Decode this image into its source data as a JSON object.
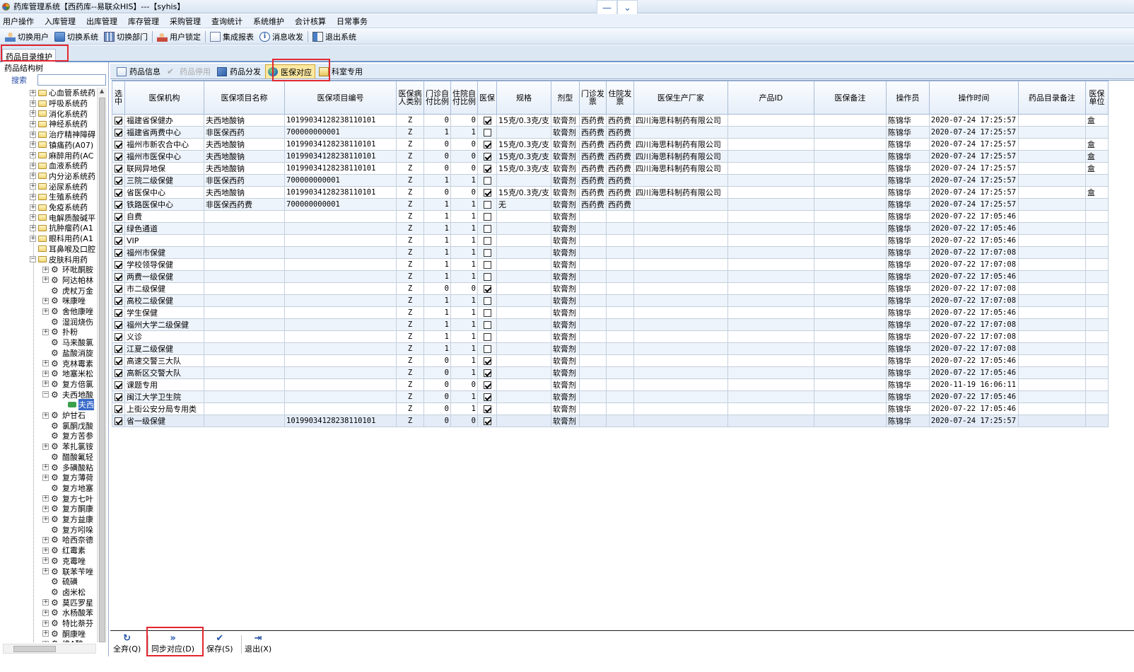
{
  "window": {
    "title": "药库管理系统【西药库--易联众HIS】---【syhis】"
  },
  "menu": [
    "用户操作",
    "入库管理",
    "出库管理",
    "库存管理",
    "采购管理",
    "查询统计",
    "系统维护",
    "会计核算",
    "日常事务"
  ],
  "toolbar": [
    {
      "label": "切换用户",
      "icon": "switch-user-icon"
    },
    {
      "label": "切换系统",
      "icon": "switch-system-icon"
    },
    {
      "label": "切换部门",
      "icon": "switch-dept-icon"
    },
    {
      "label": "用户锁定",
      "icon": "user-lock-icon"
    },
    {
      "label": "集成报表",
      "icon": "report-icon"
    },
    {
      "label": "消息收发",
      "icon": "message-icon"
    },
    {
      "label": "退出系统",
      "icon": "exit-icon"
    }
  ],
  "doc_tab": "药品目录维护",
  "tree": {
    "header": "药品结构树",
    "search_label": "搜索",
    "search_value": "",
    "items": [
      {
        "label": "心血管系统药",
        "level": 1,
        "type": "folder",
        "expander": "+"
      },
      {
        "label": "呼吸系统药",
        "level": 1,
        "type": "folder",
        "expander": "+"
      },
      {
        "label": "消化系统药",
        "level": 1,
        "type": "folder",
        "expander": "+"
      },
      {
        "label": "神经系统药",
        "level": 1,
        "type": "folder",
        "expander": "+"
      },
      {
        "label": "治疗精神障碍",
        "level": 1,
        "type": "folder",
        "expander": "+"
      },
      {
        "label": "镇痛药(A07)",
        "level": 1,
        "type": "folder",
        "expander": "+"
      },
      {
        "label": "麻醉用药(AC",
        "level": 1,
        "type": "folder",
        "expander": "+"
      },
      {
        "label": "血液系统药",
        "level": 1,
        "type": "folder",
        "expander": "+"
      },
      {
        "label": "内分泌系统药",
        "level": 1,
        "type": "folder",
        "expander": "+"
      },
      {
        "label": "泌尿系统药",
        "level": 1,
        "type": "folder",
        "expander": "+"
      },
      {
        "label": "生殖系统药",
        "level": 1,
        "type": "folder",
        "expander": "+"
      },
      {
        "label": "免疫系统药",
        "level": 1,
        "type": "folder",
        "expander": "+"
      },
      {
        "label": "电解质酸碱平",
        "level": 1,
        "type": "folder",
        "expander": "+"
      },
      {
        "label": "抗肿瘤药(A1",
        "level": 1,
        "type": "folder",
        "expander": "+"
      },
      {
        "label": "眼科用药(A1",
        "level": 1,
        "type": "folder",
        "expander": "+"
      },
      {
        "label": "耳鼻喉及口腔",
        "level": 1,
        "type": "folder",
        "expander": ""
      },
      {
        "label": "皮肤科用药",
        "level": 1,
        "type": "folder",
        "expander": "-"
      },
      {
        "label": "环吡酮胺",
        "level": 2,
        "type": "gear",
        "expander": "+"
      },
      {
        "label": "阿达帕林",
        "level": 2,
        "type": "gear",
        "expander": "+"
      },
      {
        "label": "虎杖万金",
        "level": 2,
        "type": "gear",
        "expander": ""
      },
      {
        "label": "咪康唑",
        "level": 2,
        "type": "gear",
        "expander": "+"
      },
      {
        "label": "舍他康唑",
        "level": 2,
        "type": "gear",
        "expander": "+"
      },
      {
        "label": "湿润烧伤",
        "level": 2,
        "type": "gear",
        "expander": ""
      },
      {
        "label": "扑粉",
        "level": 2,
        "type": "gear",
        "expander": "+"
      },
      {
        "label": "马来酸氯",
        "level": 2,
        "type": "gear",
        "expander": ""
      },
      {
        "label": "盐酸消旋",
        "level": 2,
        "type": "gear",
        "expander": ""
      },
      {
        "label": "克林霉素",
        "level": 2,
        "type": "gear",
        "expander": "+"
      },
      {
        "label": "地塞米松",
        "level": 2,
        "type": "gear",
        "expander": "+"
      },
      {
        "label": "复方倍氯",
        "level": 2,
        "type": "gear",
        "expander": "+"
      },
      {
        "label": "夫西地酸",
        "level": 2,
        "type": "gear",
        "expander": "-"
      },
      {
        "label": "夫西",
        "level": 3,
        "type": "leaf",
        "expander": "",
        "selected": true
      },
      {
        "label": "炉甘石",
        "level": 2,
        "type": "gear",
        "expander": "+"
      },
      {
        "label": "氯酮戊酸",
        "level": 2,
        "type": "gear",
        "expander": ""
      },
      {
        "label": "复方苦参",
        "level": 2,
        "type": "gear",
        "expander": ""
      },
      {
        "label": "苯扎氯铵",
        "level": 2,
        "type": "gear",
        "expander": "+"
      },
      {
        "label": "醋酸氟轻",
        "level": 2,
        "type": "gear",
        "expander": ""
      },
      {
        "label": "多磺酸粘",
        "level": 2,
        "type": "gear",
        "expander": "+"
      },
      {
        "label": "复方薄荷",
        "level": 2,
        "type": "gear",
        "expander": "+"
      },
      {
        "label": "复方地塞",
        "level": 2,
        "type": "gear",
        "expander": ""
      },
      {
        "label": "复方七叶",
        "level": 2,
        "type": "gear",
        "expander": "+"
      },
      {
        "label": "复方酮康",
        "level": 2,
        "type": "gear",
        "expander": "+"
      },
      {
        "label": "复方益康",
        "level": 2,
        "type": "gear",
        "expander": "+"
      },
      {
        "label": "复方吲哚",
        "level": 2,
        "type": "gear",
        "expander": ""
      },
      {
        "label": "哈西奈德",
        "level": 2,
        "type": "gear",
        "expander": "+"
      },
      {
        "label": "红霉素",
        "level": 2,
        "type": "gear",
        "expander": "+"
      },
      {
        "label": "克霉唑",
        "level": 2,
        "type": "gear",
        "expander": "+"
      },
      {
        "label": "联苯苄唑",
        "level": 2,
        "type": "gear",
        "expander": "+"
      },
      {
        "label": "硫磺",
        "level": 2,
        "type": "gear",
        "expander": ""
      },
      {
        "label": "卤米松",
        "level": 2,
        "type": "gear",
        "expander": ""
      },
      {
        "label": "莫匹罗星",
        "level": 2,
        "type": "gear",
        "expander": "+"
      },
      {
        "label": "水杨酸苯",
        "level": 2,
        "type": "gear",
        "expander": "+"
      },
      {
        "label": "特比萘芬",
        "level": 2,
        "type": "gear",
        "expander": "+"
      },
      {
        "label": "酮康唑",
        "level": 2,
        "type": "gear",
        "expander": "+"
      },
      {
        "label": "维A酸",
        "level": 2,
        "type": "gear",
        "expander": "+"
      }
    ]
  },
  "subtabs": [
    {
      "label": "药品信息",
      "icon": "drug-info-icon",
      "state": "normal"
    },
    {
      "label": "药品停用",
      "icon": "check-icon",
      "state": "disabled"
    },
    {
      "label": "药品分发",
      "icon": "distribute-icon",
      "state": "normal"
    },
    {
      "label": "医保对应",
      "icon": "globe-icon",
      "state": "active"
    },
    {
      "label": "科室专用",
      "icon": "dept-icon",
      "state": "normal"
    }
  ],
  "table": {
    "columns": [
      "选中",
      "医保机构",
      "医保项目名称",
      "医保项目编号",
      "医保病人类别",
      "门诊自付比例",
      "住院自付比例",
      "医保",
      "规格",
      "剂型",
      "门诊发票",
      "住院发票",
      "医保生产厂家",
      "产品ID",
      "医保备注",
      "操作员",
      "操作时间",
      "药品目录备注",
      "医保单位"
    ],
    "rows": [
      {
        "sel": true,
        "org": "福建省保健办",
        "item": "夫西地酸钠",
        "code": "10199034128238110101",
        "cat": "Z",
        "op": "0",
        "ip": "0",
        "yb": true,
        "spec": "15克/0.3克/支",
        "form": "软膏剂",
        "opinv": "西药费",
        "ipinv": "西药费",
        "maker": "四川海思科制药有限公司",
        "pid": "",
        "note": "",
        "oper": "陈锦华",
        "time": "2020-07-24 17:25:57",
        "catnote": "",
        "unit": "盒"
      },
      {
        "sel": true,
        "org": "福建省两费中心",
        "item": "非医保西药",
        "code": "700000000001",
        "cat": "Z",
        "op": "1",
        "ip": "1",
        "yb": false,
        "spec": "",
        "form": "软膏剂",
        "opinv": "西药费",
        "ipinv": "西药费",
        "maker": "",
        "pid": "",
        "note": "",
        "oper": "陈锦华",
        "time": "2020-07-24 17:25:57",
        "catnote": "",
        "unit": ""
      },
      {
        "sel": true,
        "org": "福州市新农合中心",
        "item": "夫西地酸钠",
        "code": "10199034128238110101",
        "cat": "Z",
        "op": "0",
        "ip": "0",
        "yb": true,
        "spec": "15克/0.3克/支",
        "form": "软膏剂",
        "opinv": "西药费",
        "ipinv": "西药费",
        "maker": "四川海思科制药有限公司",
        "pid": "",
        "note": "",
        "oper": "陈锦华",
        "time": "2020-07-24 17:25:57",
        "catnote": "",
        "unit": "盒"
      },
      {
        "sel": true,
        "org": "福州市医保中心",
        "item": "夫西地酸钠",
        "code": "10199034128238110101",
        "cat": "Z",
        "op": "0",
        "ip": "0",
        "yb": true,
        "spec": "15克/0.3克/支",
        "form": "软膏剂",
        "opinv": "西药费",
        "ipinv": "西药费",
        "maker": "四川海思科制药有限公司",
        "pid": "",
        "note": "",
        "oper": "陈锦华",
        "time": "2020-07-24 17:25:57",
        "catnote": "",
        "unit": "盒"
      },
      {
        "sel": true,
        "org": "联网异地保",
        "item": "夫西地酸钠",
        "code": "10199034128238110101",
        "cat": "Z",
        "op": "0",
        "ip": "0",
        "yb": true,
        "spec": "15克/0.3克/支",
        "form": "软膏剂",
        "opinv": "西药费",
        "ipinv": "西药费",
        "maker": "四川海思科制药有限公司",
        "pid": "",
        "note": "",
        "oper": "陈锦华",
        "time": "2020-07-24 17:25:57",
        "catnote": "",
        "unit": "盒"
      },
      {
        "sel": true,
        "org": "三院二级保健",
        "item": "非医保西药",
        "code": "700000000001",
        "cat": "Z",
        "op": "1",
        "ip": "1",
        "yb": false,
        "spec": "",
        "form": "软膏剂",
        "opinv": "西药费",
        "ipinv": "西药费",
        "maker": "",
        "pid": "",
        "note": "",
        "oper": "陈锦华",
        "time": "2020-07-24 17:25:57",
        "catnote": "",
        "unit": ""
      },
      {
        "sel": true,
        "org": "省医保中心",
        "item": "夫西地酸钠",
        "code": "10199034128238110101",
        "cat": "Z",
        "op": "0",
        "ip": "0",
        "yb": true,
        "spec": "15克/0.3克/支",
        "form": "软膏剂",
        "opinv": "西药费",
        "ipinv": "西药费",
        "maker": "四川海思科制药有限公司",
        "pid": "",
        "note": "",
        "oper": "陈锦华",
        "time": "2020-07-24 17:25:57",
        "catnote": "",
        "unit": "盒"
      },
      {
        "sel": true,
        "org": "铁路医保中心",
        "item": "非医保西药费",
        "code": "700000000001",
        "cat": "Z",
        "op": "1",
        "ip": "1",
        "yb": false,
        "spec": "无",
        "form": "软膏剂",
        "opinv": "西药费",
        "ipinv": "西药费",
        "maker": "",
        "pid": "",
        "note": "",
        "oper": "陈锦华",
        "time": "2020-07-24 17:25:57",
        "catnote": "",
        "unit": ""
      },
      {
        "sel": true,
        "org": "自费",
        "item": "",
        "code": "",
        "cat": "Z",
        "op": "1",
        "ip": "1",
        "yb": false,
        "spec": "",
        "form": "软膏剂",
        "opinv": "",
        "ipinv": "",
        "maker": "",
        "pid": "",
        "note": "",
        "oper": "陈锦华",
        "time": "2020-07-22 17:05:46",
        "catnote": "",
        "unit": ""
      },
      {
        "sel": true,
        "org": "绿色通道",
        "item": "",
        "code": "",
        "cat": "Z",
        "op": "1",
        "ip": "1",
        "yb": false,
        "spec": "",
        "form": "软膏剂",
        "opinv": "",
        "ipinv": "",
        "maker": "",
        "pid": "",
        "note": "",
        "oper": "陈锦华",
        "time": "2020-07-22 17:05:46",
        "catnote": "",
        "unit": ""
      },
      {
        "sel": true,
        "org": "VIP",
        "item": "",
        "code": "",
        "cat": "Z",
        "op": "1",
        "ip": "1",
        "yb": false,
        "spec": "",
        "form": "软膏剂",
        "opinv": "",
        "ipinv": "",
        "maker": "",
        "pid": "",
        "note": "",
        "oper": "陈锦华",
        "time": "2020-07-22 17:05:46",
        "catnote": "",
        "unit": ""
      },
      {
        "sel": true,
        "org": "福州市保健",
        "item": "",
        "code": "",
        "cat": "Z",
        "op": "1",
        "ip": "1",
        "yb": false,
        "spec": "",
        "form": "软膏剂",
        "opinv": "",
        "ipinv": "",
        "maker": "",
        "pid": "",
        "note": "",
        "oper": "陈锦华",
        "time": "2020-07-22 17:07:08",
        "catnote": "",
        "unit": ""
      },
      {
        "sel": true,
        "org": "学校领导保健",
        "item": "",
        "code": "",
        "cat": "Z",
        "op": "1",
        "ip": "1",
        "yb": false,
        "spec": "",
        "form": "软膏剂",
        "opinv": "",
        "ipinv": "",
        "maker": "",
        "pid": "",
        "note": "",
        "oper": "陈锦华",
        "time": "2020-07-22 17:07:08",
        "catnote": "",
        "unit": ""
      },
      {
        "sel": true,
        "org": "两费一级保健",
        "item": "",
        "code": "",
        "cat": "Z",
        "op": "1",
        "ip": "1",
        "yb": false,
        "spec": "",
        "form": "软膏剂",
        "opinv": "",
        "ipinv": "",
        "maker": "",
        "pid": "",
        "note": "",
        "oper": "陈锦华",
        "time": "2020-07-22 17:05:46",
        "catnote": "",
        "unit": ""
      },
      {
        "sel": true,
        "org": "市二级保健",
        "item": "",
        "code": "",
        "cat": "Z",
        "op": "0",
        "ip": "0",
        "yb": true,
        "spec": "",
        "form": "软膏剂",
        "opinv": "",
        "ipinv": "",
        "maker": "",
        "pid": "",
        "note": "",
        "oper": "陈锦华",
        "time": "2020-07-22 17:07:08",
        "catnote": "",
        "unit": ""
      },
      {
        "sel": true,
        "org": "高校二级保健",
        "item": "",
        "code": "",
        "cat": "Z",
        "op": "1",
        "ip": "1",
        "yb": false,
        "spec": "",
        "form": "软膏剂",
        "opinv": "",
        "ipinv": "",
        "maker": "",
        "pid": "",
        "note": "",
        "oper": "陈锦华",
        "time": "2020-07-22 17:07:08",
        "catnote": "",
        "unit": ""
      },
      {
        "sel": true,
        "org": "学生保健",
        "item": "",
        "code": "",
        "cat": "Z",
        "op": "1",
        "ip": "1",
        "yb": false,
        "spec": "",
        "form": "软膏剂",
        "opinv": "",
        "ipinv": "",
        "maker": "",
        "pid": "",
        "note": "",
        "oper": "陈锦华",
        "time": "2020-07-22 17:05:46",
        "catnote": "",
        "unit": ""
      },
      {
        "sel": true,
        "org": "福州大学二级保健",
        "item": "",
        "code": "",
        "cat": "Z",
        "op": "1",
        "ip": "1",
        "yb": false,
        "spec": "",
        "form": "软膏剂",
        "opinv": "",
        "ipinv": "",
        "maker": "",
        "pid": "",
        "note": "",
        "oper": "陈锦华",
        "time": "2020-07-22 17:07:08",
        "catnote": "",
        "unit": ""
      },
      {
        "sel": true,
        "org": "义诊",
        "item": "",
        "code": "",
        "cat": "Z",
        "op": "1",
        "ip": "1",
        "yb": false,
        "spec": "",
        "form": "软膏剂",
        "opinv": "",
        "ipinv": "",
        "maker": "",
        "pid": "",
        "note": "",
        "oper": "陈锦华",
        "time": "2020-07-22 17:07:08",
        "catnote": "",
        "unit": ""
      },
      {
        "sel": true,
        "org": "江夏二级保健",
        "item": "",
        "code": "",
        "cat": "Z",
        "op": "1",
        "ip": "1",
        "yb": false,
        "spec": "",
        "form": "软膏剂",
        "opinv": "",
        "ipinv": "",
        "maker": "",
        "pid": "",
        "note": "",
        "oper": "陈锦华",
        "time": "2020-07-22 17:07:08",
        "catnote": "",
        "unit": ""
      },
      {
        "sel": true,
        "org": "高速交警三大队",
        "item": "",
        "code": "",
        "cat": "Z",
        "op": "0",
        "ip": "1",
        "yb": true,
        "spec": "",
        "form": "软膏剂",
        "opinv": "",
        "ipinv": "",
        "maker": "",
        "pid": "",
        "note": "",
        "oper": "陈锦华",
        "time": "2020-07-22 17:05:46",
        "catnote": "",
        "unit": ""
      },
      {
        "sel": true,
        "org": "高新区交警大队",
        "item": "",
        "code": "",
        "cat": "Z",
        "op": "0",
        "ip": "1",
        "yb": true,
        "spec": "",
        "form": "软膏剂",
        "opinv": "",
        "ipinv": "",
        "maker": "",
        "pid": "",
        "note": "",
        "oper": "陈锦华",
        "time": "2020-07-22 17:05:46",
        "catnote": "",
        "unit": ""
      },
      {
        "sel": true,
        "org": "课题专用",
        "item": "",
        "code": "",
        "cat": "Z",
        "op": "0",
        "ip": "0",
        "yb": true,
        "spec": "",
        "form": "软膏剂",
        "opinv": "",
        "ipinv": "",
        "maker": "",
        "pid": "",
        "note": "",
        "oper": "陈锦华",
        "time": "2020-11-19 16:06:11",
        "catnote": "",
        "unit": ""
      },
      {
        "sel": true,
        "org": "闽江大学卫生院",
        "item": "",
        "code": "",
        "cat": "Z",
        "op": "0",
        "ip": "1",
        "yb": true,
        "spec": "",
        "form": "软膏剂",
        "opinv": "",
        "ipinv": "",
        "maker": "",
        "pid": "",
        "note": "",
        "oper": "陈锦华",
        "time": "2020-07-22 17:05:46",
        "catnote": "",
        "unit": ""
      },
      {
        "sel": true,
        "org": "上街公安分局专用类",
        "item": "",
        "code": "",
        "cat": "Z",
        "op": "0",
        "ip": "1",
        "yb": true,
        "spec": "",
        "form": "软膏剂",
        "opinv": "",
        "ipinv": "",
        "maker": "",
        "pid": "",
        "note": "",
        "oper": "陈锦华",
        "time": "2020-07-22 17:05:46",
        "catnote": "",
        "unit": ""
      },
      {
        "sel": true,
        "org": "省一级保健",
        "item": "",
        "code": "10199034128238110101",
        "cat": "Z",
        "op": "0",
        "ip": "0",
        "yb": true,
        "spec": "",
        "form": "软膏剂",
        "opinv": "",
        "ipinv": "",
        "maker": "",
        "pid": "",
        "note": "",
        "oper": "陈锦华",
        "time": "2020-07-24 17:25:57",
        "catnote": "",
        "unit": ""
      }
    ]
  },
  "bottom": [
    {
      "label": "全弃(Q)",
      "icon": "refresh-icon"
    },
    {
      "label": "同步对应(D)",
      "icon": "double-chevron-icon"
    },
    {
      "label": "保存(S)",
      "icon": "checkmark-icon"
    },
    {
      "label": "退出(X)",
      "icon": "exit-door-icon"
    }
  ],
  "colors": {
    "highlight": "#e3262f",
    "active_tab": "#fbe7a0"
  }
}
